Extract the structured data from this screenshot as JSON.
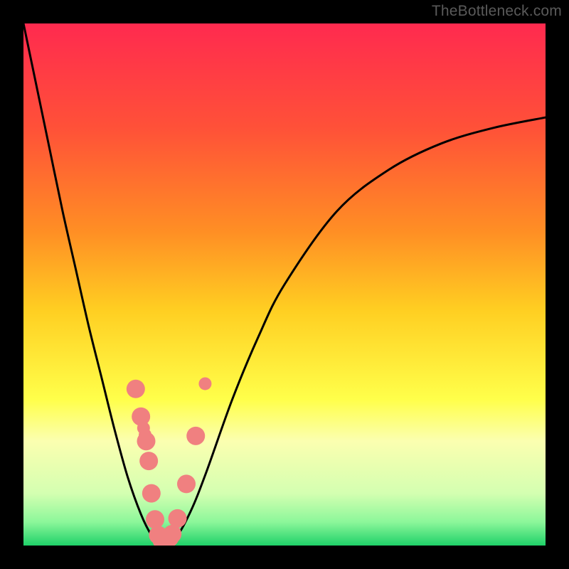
{
  "watermark": "TheBottleneck.com",
  "chart_data": {
    "type": "line",
    "title": "",
    "xlabel": "",
    "ylabel": "",
    "xlim": [
      0,
      1
    ],
    "ylim": [
      0,
      1
    ],
    "gradient_stops": [
      {
        "offset": 0.0,
        "color": "#ff2a4f"
      },
      {
        "offset": 0.2,
        "color": "#ff5138"
      },
      {
        "offset": 0.4,
        "color": "#ff8f24"
      },
      {
        "offset": 0.55,
        "color": "#ffcf22"
      },
      {
        "offset": 0.72,
        "color": "#ffff4a"
      },
      {
        "offset": 0.8,
        "color": "#fbffb0"
      },
      {
        "offset": 0.9,
        "color": "#d4ffb1"
      },
      {
        "offset": 0.955,
        "color": "#8cf79a"
      },
      {
        "offset": 1.0,
        "color": "#1fd169"
      }
    ],
    "curve": {
      "x": [
        0.0,
        0.025,
        0.05,
        0.075,
        0.1,
        0.125,
        0.15,
        0.175,
        0.2,
        0.225,
        0.245,
        0.26,
        0.268,
        0.29,
        0.32,
        0.35,
        0.4,
        0.45,
        0.5,
        0.6,
        0.7,
        0.8,
        0.9,
        1.0
      ],
      "y": [
        1.0,
        0.88,
        0.76,
        0.64,
        0.53,
        0.42,
        0.32,
        0.22,
        0.13,
        0.06,
        0.02,
        0.005,
        0.002,
        0.012,
        0.065,
        0.14,
        0.28,
        0.4,
        0.5,
        0.64,
        0.72,
        0.77,
        0.8,
        0.82
      ]
    },
    "markers": {
      "color": "#f08080",
      "radius_large": 13,
      "radius_small": 9,
      "x": [
        0.215,
        0.225,
        0.23,
        0.233,
        0.235,
        0.24,
        0.245,
        0.252,
        0.258,
        0.265,
        0.272,
        0.276,
        0.28,
        0.285,
        0.295,
        0.312,
        0.33,
        0.348
      ],
      "y": [
        0.3,
        0.247,
        0.225,
        0.212,
        0.2,
        0.162,
        0.1,
        0.05,
        0.02,
        0.01,
        0.01,
        0.013,
        0.015,
        0.022,
        0.052,
        0.118,
        0.21,
        0.31
      ],
      "r": [
        13,
        13,
        9,
        9,
        13,
        13,
        13,
        13,
        13,
        13,
        13,
        9,
        13,
        13,
        13,
        13,
        13,
        9
      ]
    }
  }
}
